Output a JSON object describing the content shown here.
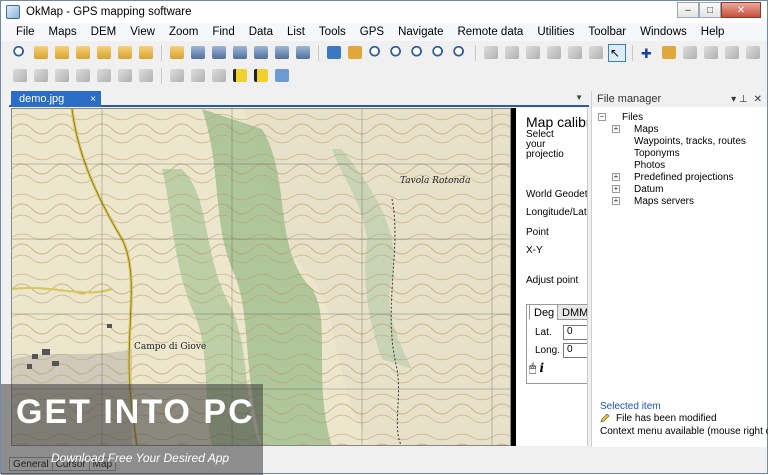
{
  "window": {
    "title": "OkMap - GPS mapping software",
    "minimize": "–",
    "maximize": "□",
    "close": "✕"
  },
  "menu": [
    "File",
    "Maps",
    "DEM",
    "View",
    "Zoom",
    "Find",
    "Data",
    "List",
    "Tools",
    "GPS",
    "Navigate",
    "Remote data",
    "Utilities",
    "Toolbar",
    "Windows",
    "Help"
  ],
  "toolbar1_icons": [
    "zoom-map-icon",
    "open-folder-icon",
    "open-folder-icon",
    "open-folder-icon",
    "open-folder-icon",
    "open-folder-icon",
    "open-folder-icon",
    "open-folder-icon",
    "save-icon",
    "save-icon",
    "save-icon",
    "save-icon",
    "save-icon",
    "save-icon",
    "map-icon",
    "map-icon",
    "zoom-in-icon",
    "zoom-in-icon",
    "zoom-out-icon",
    "zoom-icon",
    "zoom-1-1-icon",
    "edit-icon",
    "edit-icon",
    "edit-icon",
    "edit-icon",
    "edit-icon",
    "edit-icon",
    "select-pointer-icon",
    "add-point-icon",
    "globe-icon",
    "edit-icon",
    "route-icon",
    "route-icon",
    "route-icon"
  ],
  "toolbar2_icons": [
    "edit-icon",
    "edit-icon",
    "edit-icon",
    "edit-icon",
    "arrow-icon",
    "arrow-icon",
    "edit-icon",
    "edit-icon",
    "edit-icon",
    "edit-icon",
    "flag-icon",
    "flag-icon",
    "layers-icon"
  ],
  "document_tab": {
    "label": "demo.jpg",
    "close": "×"
  },
  "map": {
    "places": [
      "Campo di Giove",
      "Tavola Rotonda"
    ]
  },
  "calibration": {
    "title": "Map calibr",
    "select_label": [
      "Select",
      "your",
      "projectio"
    ],
    "world_geodetic": "World Geodetic",
    "longitude_latitude": "Longitude/Latitu",
    "point_label": "Point",
    "xy_label": "X-Y",
    "adjust_point": "Adjust point",
    "tabs": [
      "Deg",
      "DMM"
    ],
    "lat_label": "Lat.",
    "long_label": "Long.",
    "lat_value": "0",
    "long_value": "0",
    "info_icon": "i"
  },
  "file_manager": {
    "title": "File manager",
    "pin": "📌",
    "close": "✕",
    "root": "Files",
    "items": [
      {
        "label": "Maps",
        "expandable": true
      },
      {
        "label": "Waypoints, tracks, routes",
        "expandable": false
      },
      {
        "label": "Toponyms",
        "expandable": false
      },
      {
        "label": "Photos",
        "expandable": false
      },
      {
        "label": "Predefined projections",
        "expandable": true
      },
      {
        "label": "Datum",
        "expandable": true
      },
      {
        "label": "Maps servers",
        "expandable": true
      }
    ],
    "selected_item_label": "Selected item",
    "status_modified": "File has been modified",
    "context_menu": "Context menu available (mouse right click)"
  },
  "bottom_tabs": [
    "General",
    "Cursor",
    "Map"
  ],
  "watermark": {
    "main": "GET INTO PC",
    "sub": "Download Free Your Desired App"
  },
  "colors": {
    "tab_blue": "#2b6cc4",
    "selected_link": "#1d55c4"
  }
}
